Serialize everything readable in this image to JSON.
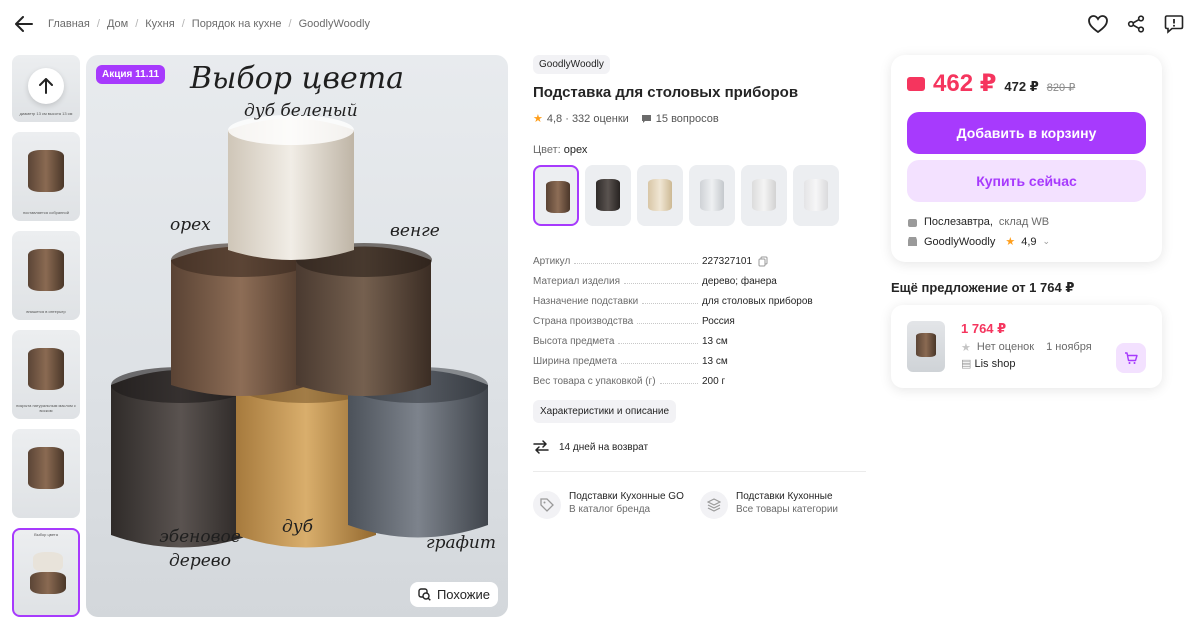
{
  "breadcrumbs": [
    "Главная",
    "Дом",
    "Кухня",
    "Порядок на кухне",
    "GoodlyWoodly"
  ],
  "gallery": {
    "thumb_captions": [
      "диаметр 13 см высота 13 см",
      "поставляется собранной",
      "впишется в интерьер",
      "покрыта натуральным маслом с воском",
      "",
      "Выбор цвета"
    ],
    "promo_badge": "Акция 11.11",
    "image_title": "Выбор цвета",
    "color_labels": {
      "bleached_oak": "дуб беленый",
      "walnut": "орех",
      "wenge": "венге",
      "ebony": "эбеновое дерево",
      "oak": "дуб",
      "graphite": "графит"
    },
    "similar_label": "Похожие"
  },
  "product": {
    "brand": "GoodlyWoodly",
    "title": "Подставка для столовых приборов",
    "rating_text": "4,8 · 332 оценки",
    "questions": "15 вопросов",
    "color_label": "Цвет:",
    "color_value": "орех",
    "specs": [
      {
        "k": "Артикул",
        "v": "227327101"
      },
      {
        "k": "Материал изделия",
        "v": "дерево; фанера"
      },
      {
        "k": "Назначение подставки",
        "v": "для столовых приборов"
      },
      {
        "k": "Страна производства",
        "v": "Россия"
      },
      {
        "k": "Высота предмета",
        "v": "13 см"
      },
      {
        "k": "Ширина предмета",
        "v": "13 см"
      },
      {
        "k": "Вес товара с упаковкой (г)",
        "v": "200 г"
      }
    ],
    "chars_button": "Характеристики и описание",
    "return_text": "14 дней на возврат",
    "categories": [
      {
        "title": "Подставки Кухонные GO",
        "sub": "В каталог бренда"
      },
      {
        "title": "Подставки Кухонные",
        "sub": "Все товары категории"
      }
    ]
  },
  "buy": {
    "price": "462 ₽",
    "price_2": "472 ₽",
    "price_old": "820 ₽",
    "add_to_cart": "Добавить в корзину",
    "buy_now": "Купить сейчас",
    "delivery": "Послезавтра,",
    "warehouse": "склад WB",
    "seller": "GoodlyWoodly",
    "seller_rating": "4,9"
  },
  "more_offers": {
    "title": "Ещё предложение от 1 764 ₽",
    "price": "1 764 ₽",
    "rating": "Нет оценок",
    "date": "1 ноября",
    "shop": "Lis shop"
  },
  "colors": {
    "accent": "#a73afd",
    "price": "#f5355e"
  }
}
